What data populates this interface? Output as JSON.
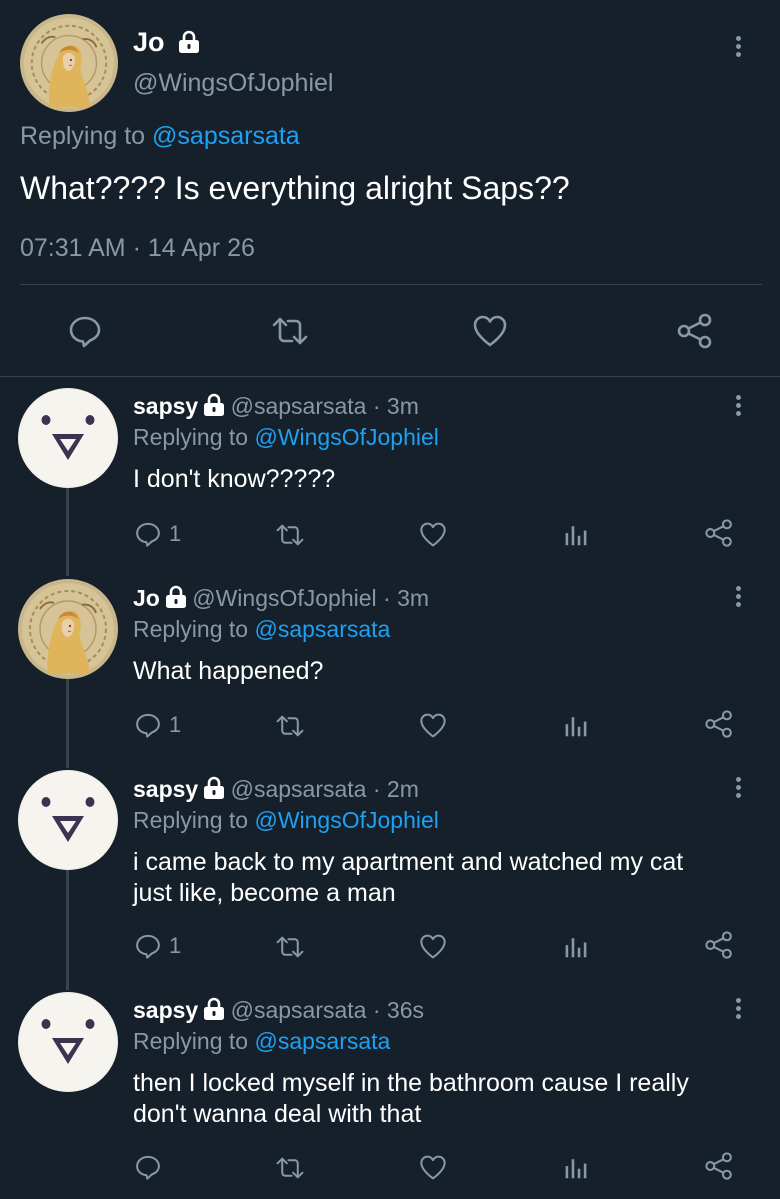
{
  "main_tweet": {
    "author_name": "Jo",
    "handle": "@WingsOfJophiel",
    "replying_label": "Replying to",
    "replying_to": "@sapsarsata",
    "text": "What???? Is everything alright Saps??",
    "timestamp": "07:31 AM · 14 Apr 26"
  },
  "replies": [
    {
      "author_name": "sapsy",
      "handle": "@sapsarsata",
      "time": "· 3m",
      "replying_label": "Replying to",
      "replying_to": "@WingsOfJophiel",
      "text_lines": [
        "I don't know?????"
      ],
      "reply_count": "1"
    },
    {
      "author_name": "Jo",
      "handle": "@WingsOfJophiel",
      "time": "· 3m",
      "replying_label": "Replying to",
      "replying_to": "@sapsarsata",
      "text_lines": [
        "What happened?"
      ],
      "reply_count": "1"
    },
    {
      "author_name": "sapsy",
      "handle": "@sapsarsata",
      "time": "· 2m",
      "replying_label": "Replying to",
      "replying_to": "@WingsOfJophiel",
      "text_lines": [
        "i came back to my apartment and watched my cat",
        "just like, become a man"
      ],
      "reply_count": "1"
    },
    {
      "author_name": "sapsy",
      "handle": "@sapsarsata",
      "time": "· 36s",
      "replying_label": "Replying to",
      "replying_to": "@sapsarsata",
      "text_lines": [
        "then I locked myself in the bathroom cause I really",
        "don't wanna deal with that"
      ],
      "reply_count": ""
    }
  ],
  "icons": [
    "lock-icon",
    "more-menu-icon",
    "reply-icon",
    "retweet-icon",
    "like-icon",
    "analytics-icon",
    "share-icon"
  ],
  "colors": {
    "background": "#15202b",
    "accent": "#1da1f2",
    "secondary_text": "#8899a6",
    "divider": "#38444d"
  }
}
